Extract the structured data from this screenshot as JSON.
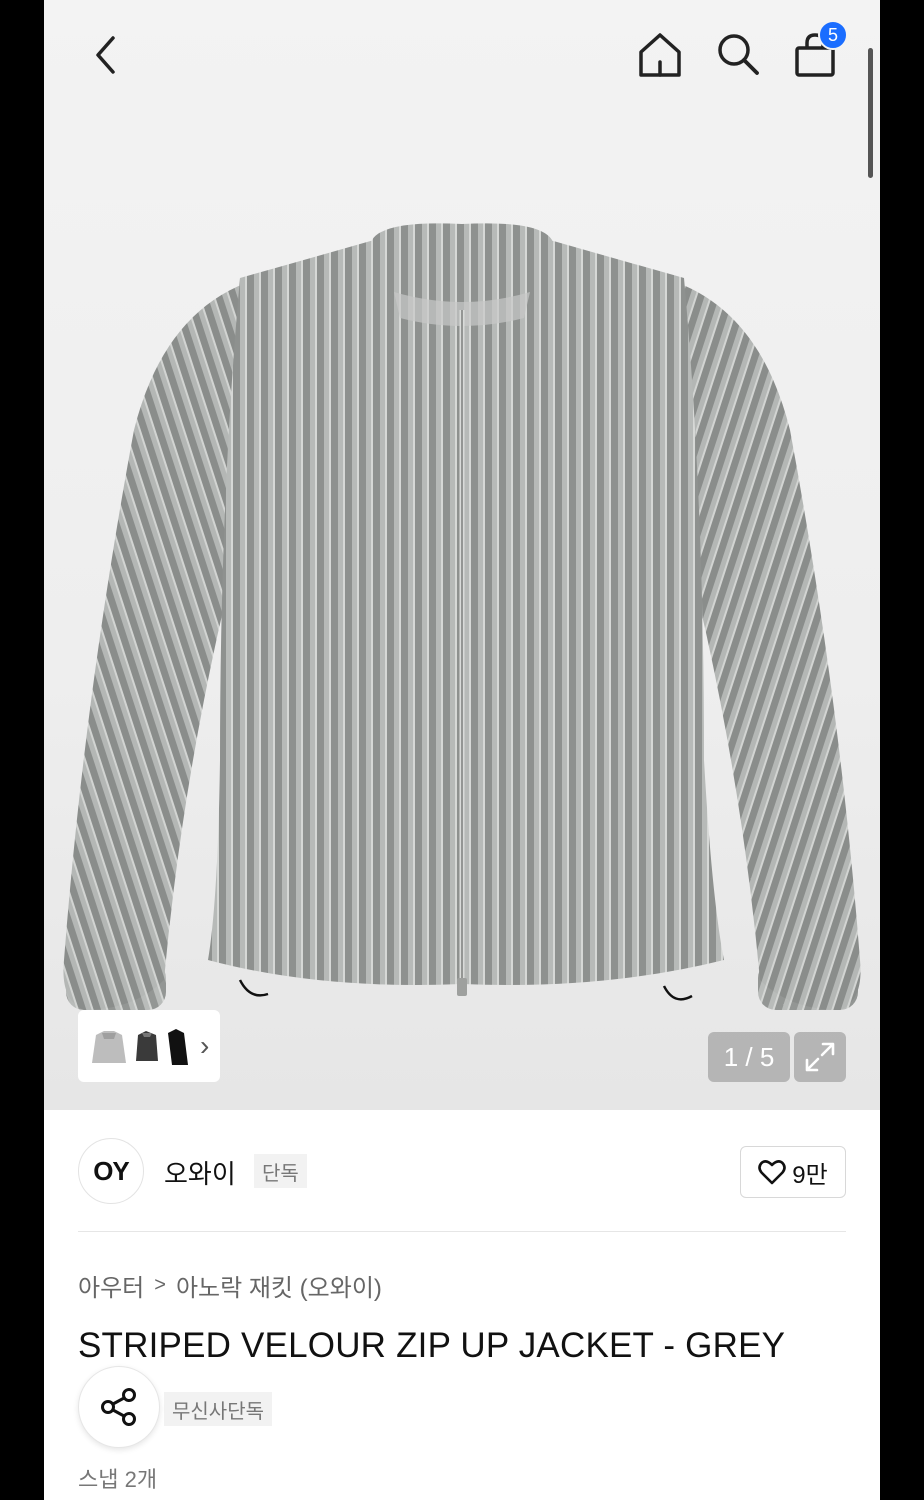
{
  "topbar": {
    "back_icon": "chevron-left-icon",
    "home_icon": "home-icon",
    "search_icon": "search-icon",
    "cart_icon": "shopping-bag-icon",
    "cart_count": "5",
    "badge_color": "#1a6dff"
  },
  "gallery": {
    "counter": "1 / 5",
    "expand_icon": "expand-icon",
    "thumbnail_chevron": "›"
  },
  "brand": {
    "logo_text": "OY",
    "name": "오와이",
    "tag": "단독",
    "like_count": "9만",
    "like_icon": "heart-icon"
  },
  "product": {
    "breadcrumb": [
      "아우터",
      "아노락 재킷 (오와이)"
    ],
    "breadcrumb_separator": ">",
    "title": "STRIPED VELOUR ZIP UP JACKET - GREY",
    "exclusive_tag": "무신사단독",
    "share_icon": "share-icon",
    "snap_text": "스냅 2개"
  }
}
